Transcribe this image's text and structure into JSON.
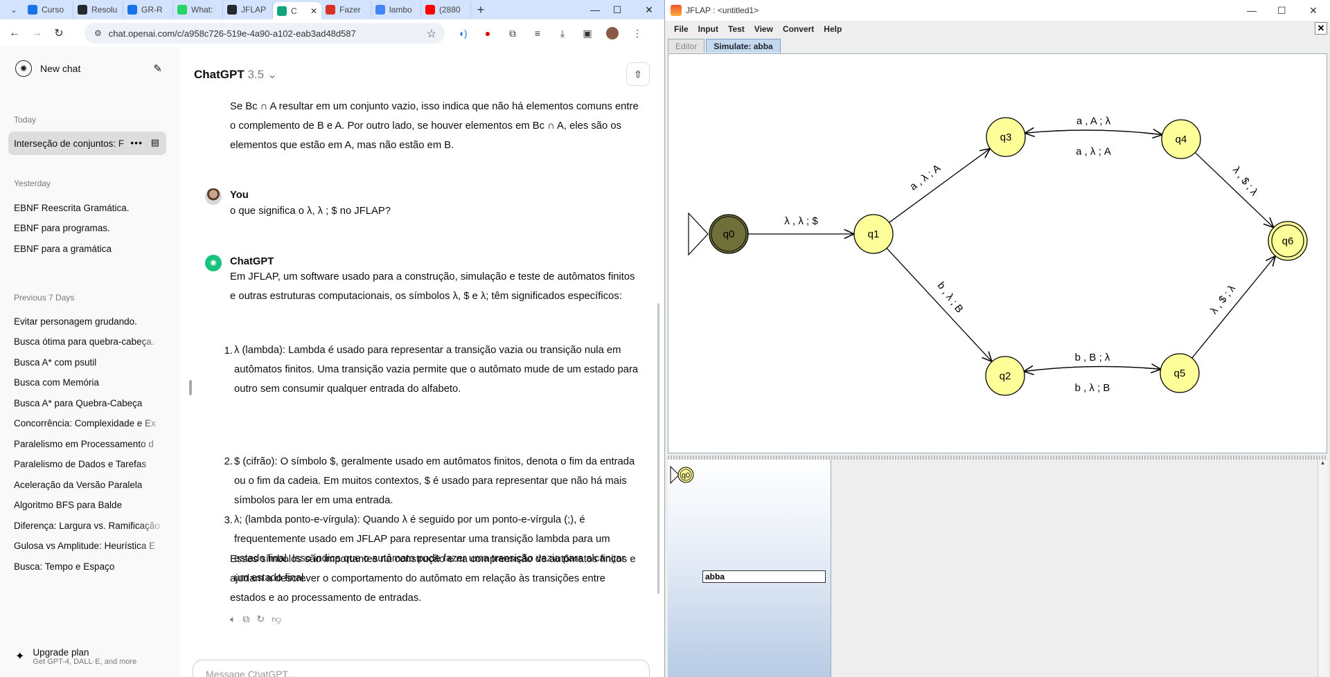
{
  "browser": {
    "tabs": [
      {
        "title": "Curso",
        "icon": "graduation-cap-icon",
        "color": "#1a73e8"
      },
      {
        "title": "Resolu",
        "icon": "github-icon",
        "color": "#24292e"
      },
      {
        "title": "GR-R",
        "icon": "graduation-cap-icon",
        "color": "#1a73e8"
      },
      {
        "title": "What:",
        "icon": "whatsapp-icon",
        "color": "#25d366"
      },
      {
        "title": "JFLAP",
        "icon": "github-icon",
        "color": "#24292e"
      },
      {
        "title": "C",
        "icon": "chatgpt-icon",
        "color": "#10a37f",
        "active": true
      },
      {
        "title": "Fazer",
        "icon": "docs-icon",
        "color": "#d93025"
      },
      {
        "title": "lambo",
        "icon": "google-icon",
        "color": "#4285f4"
      },
      {
        "title": "(2880",
        "icon": "youtube-icon",
        "color": "#ff0000"
      }
    ],
    "url": "chat.openai.com/c/a958c726-519e-4a90-a102-eab3ad48d587"
  },
  "chatgpt": {
    "new_chat": "New chat",
    "sections": {
      "today": "Today",
      "yesterday": "Yesterday",
      "previous7": "Previous 7 Days"
    },
    "today_items": [
      "Interseção de conjuntos: F"
    ],
    "yesterday_items": [
      "EBNF Reescrita Gramática.",
      "EBNF para programas.",
      "EBNF para a gramática"
    ],
    "previous_items": [
      "Evitar personagem grudando.",
      "Busca ótima para quebra-cabeça.",
      "Busca A* com psutil",
      "Busca com Memória",
      "Busca A* para Quebra-Cabeça",
      "Concorrência: Complexidade e Ex",
      "Paralelismo em Processamento d",
      "Paralelismo de Dados e Tarefas",
      "Aceleração da Versão Paralela",
      "Algoritmo BFS para Balde",
      "Diferença: Largura vs. Ramificação",
      "Gulosa vs Amplitude: Heurística E",
      "Busca: Tempo e Espaço"
    ],
    "upgrade_title": "Upgrade plan",
    "upgrade_sub": "Get GPT-4, DALL·E, and more",
    "model_name": "ChatGPT",
    "model_version": "3.5",
    "prev_answer_tail": "Se Bc ∩ A resultar em um conjunto vazio, isso indica que não há elementos comuns entre o complemento de B e A. Por outro lado, se houver elementos em Bc ∩ A, eles são os elementos que estão em A, mas não estão em B.",
    "user_name": "You",
    "user_msg": "o que significa o λ, λ ; $ no JFLAP?",
    "gpt_name": "ChatGPT",
    "gpt_intro": "Em JFLAP, um software usado para a construção, simulação e teste de autômatos finitos e outras estruturas computacionais, os símbolos λ, $ e λ; têm significados específicos:",
    "gpt_list": [
      "λ (lambda): Lambda é usado para representar a transição vazia ou transição nula em autômatos finitos. Uma transição vazia permite que o autômato mude de um estado para outro sem consumir qualquer entrada do alfabeto.",
      "$ (cifrão): O símbolo $, geralmente usado em autômatos finitos, denota o fim da entrada ou o fim da cadeia. Em muitos contextos, $ é usado para representar que não há mais símbolos para ler em uma entrada.",
      "λ; (lambda ponto-e-vírgula): Quando λ é seguido por um ponto-e-vírgula (;), é frequentemente usado em JFLAP para representar uma transição lambda para um estado final. Isso indica que o autômato pode fazer uma transição vazia para alcançar um estado final."
    ],
    "gpt_outro": "Esses símbolos são importantes na construção e na compreensão de autômatos finitos e ajudam a descrever o comportamento do autômato em relação às transições entre estados e ao processamento de entradas.",
    "composer_placeholder": "Message ChatGPT..."
  },
  "jflap": {
    "title": "JFLAP : <untitled1>",
    "menu": [
      "File",
      "Input",
      "Test",
      "View",
      "Convert",
      "Help"
    ],
    "tabs": [
      "Editor",
      "Simulate: abba"
    ],
    "states": [
      "q0",
      "q1",
      "q2",
      "q3",
      "q4",
      "q5",
      "q6"
    ],
    "transitions": [
      "λ , λ ; $",
      "a , λ ; A",
      "a , A ; λ",
      "a , λ ; A",
      "λ , $ ; λ",
      "b , λ ; B",
      "b , B ; λ",
      "b , λ ; B",
      "λ , $ ; λ"
    ],
    "config_state": "q0",
    "config_input": "abba",
    "colors": {
      "state_fill": "#ffff99",
      "current_state": "#6f6f3a",
      "canvas_bg": "#ffffff"
    }
  }
}
